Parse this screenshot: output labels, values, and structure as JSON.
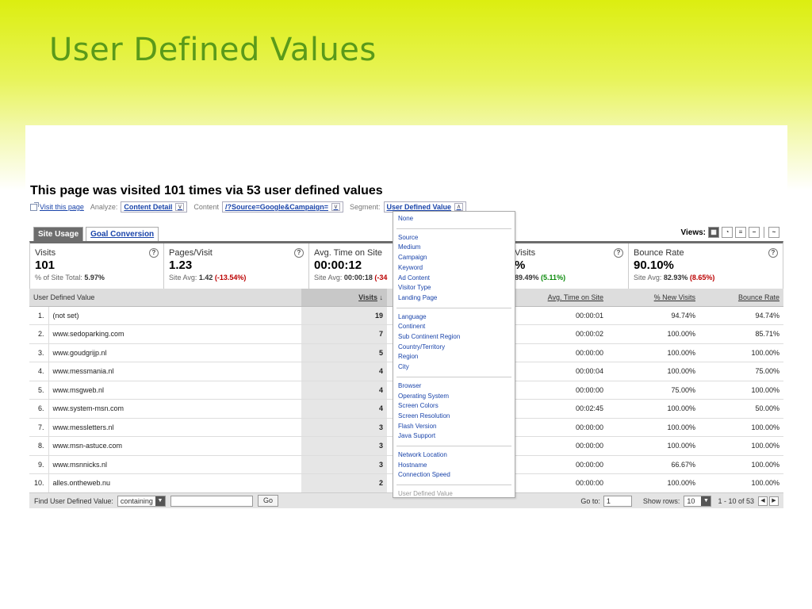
{
  "slide": {
    "title": "User Defined Values"
  },
  "report": {
    "heading": "This page was visited 101 times via 53 user defined values",
    "visit_link": "Visit this page",
    "analyze_label": "Analyze:",
    "analyze_value": "Content Detail",
    "content_label": "Content",
    "content_value": "/?Source=Google&Campaign=",
    "segment_label": "Segment:",
    "segment_value": "User Defined Value"
  },
  "tabs": [
    {
      "label": "Site Usage",
      "active": true
    },
    {
      "label": "Goal Conversion",
      "active": false
    }
  ],
  "views_label": "Views:",
  "summary": [
    {
      "title": "Visits",
      "value": "101",
      "sub_prefix": "% of Site Total: ",
      "sub_bold": "5.97%",
      "delta": "",
      "delta_class": ""
    },
    {
      "title": "Pages/Visit",
      "value": "1.23",
      "sub_prefix": "Site Avg: ",
      "sub_bold": "1.42",
      "delta": "(-13.54%)",
      "delta_class": "neg"
    },
    {
      "title": "Avg. Time on Site",
      "value": "00:00:12",
      "sub_prefix": "Site Avg: ",
      "sub_bold": "00:00:18",
      "delta": "(-34",
      "delta_class": "neg"
    },
    {
      "title": "Visits",
      "value": "%",
      "sub_prefix": "",
      "sub_bold": "89.49%",
      "delta": "(5.11%)",
      "delta_class": "pos"
    },
    {
      "title": "Bounce Rate",
      "value": "90.10%",
      "sub_prefix": "Site Avg: ",
      "sub_bold": "82.93%",
      "delta": "(8.65%)",
      "delta_class": "neg"
    }
  ],
  "table": {
    "headers": {
      "dimension": "User Defined Value",
      "visits": "Visits",
      "sort_arrow": "↓",
      "avg_time": "Avg. Time on Site",
      "new_visits": "% New Visits",
      "bounce": "Bounce Rate"
    },
    "rows": [
      {
        "n": "1.",
        "name": "(not set)",
        "visits": "19",
        "time": "00:00:01",
        "new": "94.74%",
        "bounce": "94.74%"
      },
      {
        "n": "2.",
        "name": "www.sedoparking.com",
        "visits": "7",
        "time": "00:00:02",
        "new": "100.00%",
        "bounce": "85.71%"
      },
      {
        "n": "3.",
        "name": "www.goudgrijp.nl",
        "visits": "5",
        "time": "00:00:00",
        "new": "100.00%",
        "bounce": "100.00%"
      },
      {
        "n": "4.",
        "name": "www.messmania.nl",
        "visits": "4",
        "time": "00:00:04",
        "new": "100.00%",
        "bounce": "75.00%"
      },
      {
        "n": "5.",
        "name": "www.msgweb.nl",
        "visits": "4",
        "time": "00:00:00",
        "new": "75.00%",
        "bounce": "100.00%"
      },
      {
        "n": "6.",
        "name": "www.system-msn.com",
        "visits": "4",
        "time": "00:02:45",
        "new": "100.00%",
        "bounce": "50.00%"
      },
      {
        "n": "7.",
        "name": "www.messletters.nl",
        "visits": "3",
        "time": "00:00:00",
        "new": "100.00%",
        "bounce": "100.00%"
      },
      {
        "n": "8.",
        "name": "www.msn-astuce.com",
        "visits": "3",
        "time": "00:00:00",
        "new": "100.00%",
        "bounce": "100.00%"
      },
      {
        "n": "9.",
        "name": "www.msnnicks.nl",
        "visits": "3",
        "time": "00:00:00",
        "new": "66.67%",
        "bounce": "100.00%"
      },
      {
        "n": "10.",
        "name": "alles.ontheweb.nu",
        "visits": "2",
        "time": "00:00:00",
        "new": "100.00%",
        "bounce": "100.00%"
      }
    ]
  },
  "footer": {
    "find_label": "Find User Defined Value:",
    "filter_value": "containing",
    "go_label": "Go",
    "goto_label": "Go to:",
    "goto_value": "1",
    "show_rows_label": "Show rows:",
    "show_rows_value": "10",
    "range": "1 - 10 of 53"
  },
  "dropdown": {
    "groups": [
      [
        "None"
      ],
      [
        "Source",
        "Medium",
        "Campaign",
        "Keyword",
        "Ad Content",
        "Visitor Type",
        "Landing Page"
      ],
      [
        "Language",
        "Continent",
        "Sub Continent Region",
        "Country/Territory",
        "Region",
        "City"
      ],
      [
        "Browser",
        "Operating System",
        "Screen Colors",
        "Screen Resolution",
        "Flash Version",
        "Java Support"
      ],
      [
        "Network Location",
        "Hostname",
        "Connection Speed"
      ]
    ],
    "disabled_item": "User Defined Value"
  },
  "colors": {
    "title_green": "#5a9a1a",
    "link_blue": "#1a44aa",
    "negative": "#bb0000",
    "positive": "#0a8a0a"
  }
}
